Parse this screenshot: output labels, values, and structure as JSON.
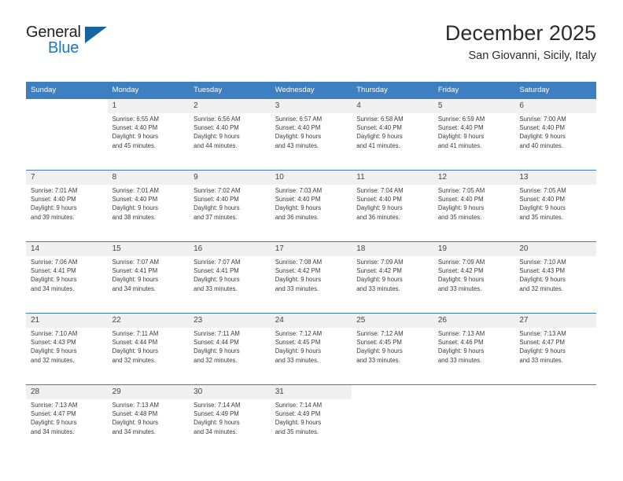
{
  "brand": {
    "name_part1": "General",
    "name_part2": "Blue",
    "logo_icon": "triangle-logo-icon"
  },
  "header": {
    "title": "December 2025",
    "subtitle": "San Giovanni, Sicily, Italy"
  },
  "calendar": {
    "weekday_headers": [
      "Sunday",
      "Monday",
      "Tuesday",
      "Wednesday",
      "Thursday",
      "Friday",
      "Saturday"
    ],
    "accent_color": "#3d7fc1",
    "daynum_band_color": "#f0f0f0",
    "weeks": [
      [
        {
          "day": "",
          "sunrise": "",
          "sunset": "",
          "daylight_line1": "",
          "daylight_line2": ""
        },
        {
          "day": "1",
          "sunrise": "Sunrise: 6:55 AM",
          "sunset": "Sunset: 4:40 PM",
          "daylight_line1": "Daylight: 9 hours",
          "daylight_line2": "and 45 minutes."
        },
        {
          "day": "2",
          "sunrise": "Sunrise: 6:56 AM",
          "sunset": "Sunset: 4:40 PM",
          "daylight_line1": "Daylight: 9 hours",
          "daylight_line2": "and 44 minutes."
        },
        {
          "day": "3",
          "sunrise": "Sunrise: 6:57 AM",
          "sunset": "Sunset: 4:40 PM",
          "daylight_line1": "Daylight: 9 hours",
          "daylight_line2": "and 43 minutes."
        },
        {
          "day": "4",
          "sunrise": "Sunrise: 6:58 AM",
          "sunset": "Sunset: 4:40 PM",
          "daylight_line1": "Daylight: 9 hours",
          "daylight_line2": "and 41 minutes."
        },
        {
          "day": "5",
          "sunrise": "Sunrise: 6:59 AM",
          "sunset": "Sunset: 4:40 PM",
          "daylight_line1": "Daylight: 9 hours",
          "daylight_line2": "and 41 minutes."
        },
        {
          "day": "6",
          "sunrise": "Sunrise: 7:00 AM",
          "sunset": "Sunset: 4:40 PM",
          "daylight_line1": "Daylight: 9 hours",
          "daylight_line2": "and 40 minutes."
        }
      ],
      [
        {
          "day": "7",
          "sunrise": "Sunrise: 7:01 AM",
          "sunset": "Sunset: 4:40 PM",
          "daylight_line1": "Daylight: 9 hours",
          "daylight_line2": "and 39 minutes."
        },
        {
          "day": "8",
          "sunrise": "Sunrise: 7:01 AM",
          "sunset": "Sunset: 4:40 PM",
          "daylight_line1": "Daylight: 9 hours",
          "daylight_line2": "and 38 minutes."
        },
        {
          "day": "9",
          "sunrise": "Sunrise: 7:02 AM",
          "sunset": "Sunset: 4:40 PM",
          "daylight_line1": "Daylight: 9 hours",
          "daylight_line2": "and 37 minutes."
        },
        {
          "day": "10",
          "sunrise": "Sunrise: 7:03 AM",
          "sunset": "Sunset: 4:40 PM",
          "daylight_line1": "Daylight: 9 hours",
          "daylight_line2": "and 36 minutes."
        },
        {
          "day": "11",
          "sunrise": "Sunrise: 7:04 AM",
          "sunset": "Sunset: 4:40 PM",
          "daylight_line1": "Daylight: 9 hours",
          "daylight_line2": "and 36 minutes."
        },
        {
          "day": "12",
          "sunrise": "Sunrise: 7:05 AM",
          "sunset": "Sunset: 4:40 PM",
          "daylight_line1": "Daylight: 9 hours",
          "daylight_line2": "and 35 minutes."
        },
        {
          "day": "13",
          "sunrise": "Sunrise: 7:05 AM",
          "sunset": "Sunset: 4:40 PM",
          "daylight_line1": "Daylight: 9 hours",
          "daylight_line2": "and 35 minutes."
        }
      ],
      [
        {
          "day": "14",
          "sunrise": "Sunrise: 7:06 AM",
          "sunset": "Sunset: 4:41 PM",
          "daylight_line1": "Daylight: 9 hours",
          "daylight_line2": "and 34 minutes."
        },
        {
          "day": "15",
          "sunrise": "Sunrise: 7:07 AM",
          "sunset": "Sunset: 4:41 PM",
          "daylight_line1": "Daylight: 9 hours",
          "daylight_line2": "and 34 minutes."
        },
        {
          "day": "16",
          "sunrise": "Sunrise: 7:07 AM",
          "sunset": "Sunset: 4:41 PM",
          "daylight_line1": "Daylight: 9 hours",
          "daylight_line2": "and 33 minutes."
        },
        {
          "day": "17",
          "sunrise": "Sunrise: 7:08 AM",
          "sunset": "Sunset: 4:42 PM",
          "daylight_line1": "Daylight: 9 hours",
          "daylight_line2": "and 33 minutes."
        },
        {
          "day": "18",
          "sunrise": "Sunrise: 7:09 AM",
          "sunset": "Sunset: 4:42 PM",
          "daylight_line1": "Daylight: 9 hours",
          "daylight_line2": "and 33 minutes."
        },
        {
          "day": "19",
          "sunrise": "Sunrise: 7:09 AM",
          "sunset": "Sunset: 4:42 PM",
          "daylight_line1": "Daylight: 9 hours",
          "daylight_line2": "and 33 minutes."
        },
        {
          "day": "20",
          "sunrise": "Sunrise: 7:10 AM",
          "sunset": "Sunset: 4:43 PM",
          "daylight_line1": "Daylight: 9 hours",
          "daylight_line2": "and 32 minutes."
        }
      ],
      [
        {
          "day": "21",
          "sunrise": "Sunrise: 7:10 AM",
          "sunset": "Sunset: 4:43 PM",
          "daylight_line1": "Daylight: 9 hours",
          "daylight_line2": "and 32 minutes."
        },
        {
          "day": "22",
          "sunrise": "Sunrise: 7:11 AM",
          "sunset": "Sunset: 4:44 PM",
          "daylight_line1": "Daylight: 9 hours",
          "daylight_line2": "and 32 minutes."
        },
        {
          "day": "23",
          "sunrise": "Sunrise: 7:11 AM",
          "sunset": "Sunset: 4:44 PM",
          "daylight_line1": "Daylight: 9 hours",
          "daylight_line2": "and 32 minutes."
        },
        {
          "day": "24",
          "sunrise": "Sunrise: 7:12 AM",
          "sunset": "Sunset: 4:45 PM",
          "daylight_line1": "Daylight: 9 hours",
          "daylight_line2": "and 33 minutes."
        },
        {
          "day": "25",
          "sunrise": "Sunrise: 7:12 AM",
          "sunset": "Sunset: 4:45 PM",
          "daylight_line1": "Daylight: 9 hours",
          "daylight_line2": "and 33 minutes."
        },
        {
          "day": "26",
          "sunrise": "Sunrise: 7:13 AM",
          "sunset": "Sunset: 4:46 PM",
          "daylight_line1": "Daylight: 9 hours",
          "daylight_line2": "and 33 minutes."
        },
        {
          "day": "27",
          "sunrise": "Sunrise: 7:13 AM",
          "sunset": "Sunset: 4:47 PM",
          "daylight_line1": "Daylight: 9 hours",
          "daylight_line2": "and 33 minutes."
        }
      ],
      [
        {
          "day": "28",
          "sunrise": "Sunrise: 7:13 AM",
          "sunset": "Sunset: 4:47 PM",
          "daylight_line1": "Daylight: 9 hours",
          "daylight_line2": "and 34 minutes."
        },
        {
          "day": "29",
          "sunrise": "Sunrise: 7:13 AM",
          "sunset": "Sunset: 4:48 PM",
          "daylight_line1": "Daylight: 9 hours",
          "daylight_line2": "and 34 minutes."
        },
        {
          "day": "30",
          "sunrise": "Sunrise: 7:14 AM",
          "sunset": "Sunset: 4:49 PM",
          "daylight_line1": "Daylight: 9 hours",
          "daylight_line2": "and 34 minutes."
        },
        {
          "day": "31",
          "sunrise": "Sunrise: 7:14 AM",
          "sunset": "Sunset: 4:49 PM",
          "daylight_line1": "Daylight: 9 hours",
          "daylight_line2": "and 35 minutes."
        },
        {
          "day": "",
          "sunrise": "",
          "sunset": "",
          "daylight_line1": "",
          "daylight_line2": ""
        },
        {
          "day": "",
          "sunrise": "",
          "sunset": "",
          "daylight_line1": "",
          "daylight_line2": ""
        },
        {
          "day": "",
          "sunrise": "",
          "sunset": "",
          "daylight_line1": "",
          "daylight_line2": ""
        }
      ]
    ]
  }
}
